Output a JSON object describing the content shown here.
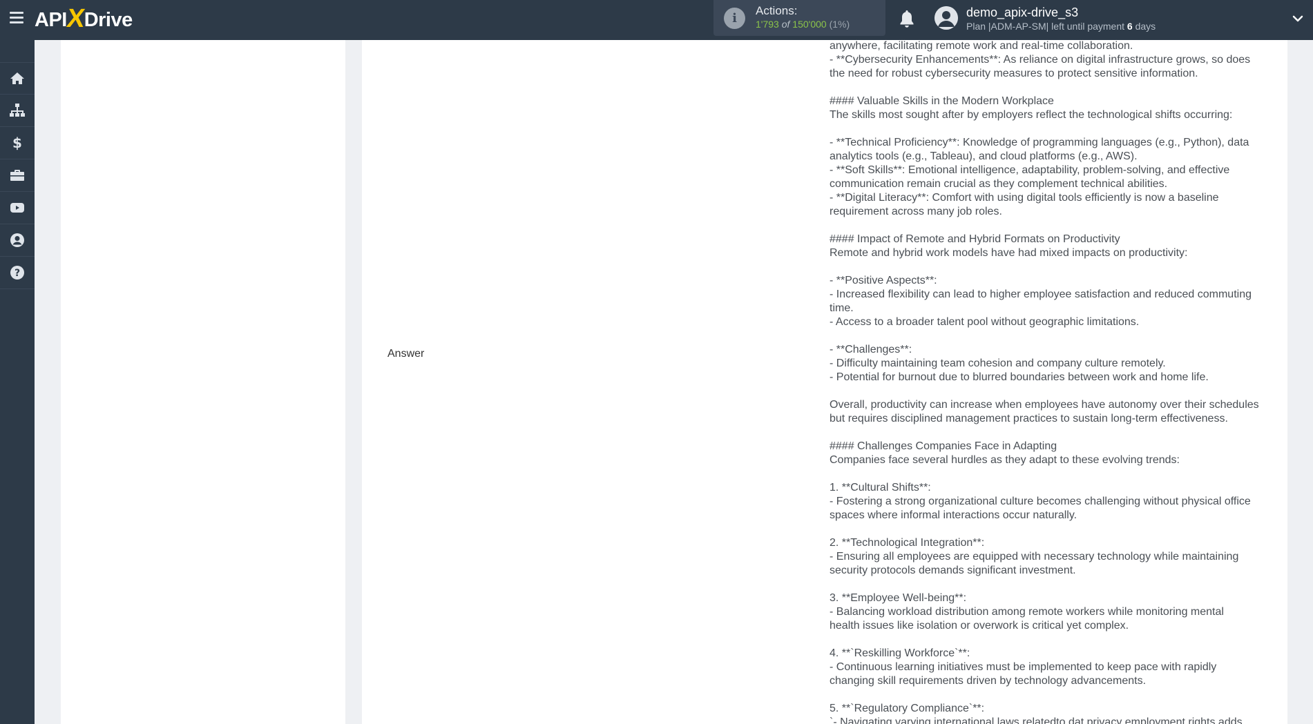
{
  "header": {
    "logo": {
      "api": "API",
      "x": "X",
      "drive": "Drive"
    },
    "actions": {
      "label": "Actions:",
      "used": "1'793",
      "of": "of",
      "total": "150'000",
      "percent": "(1%)"
    },
    "user": {
      "name": "demo_apix-drive_s3",
      "plan_prefix": "Plan |ADM-AP-SM| left until payment",
      "days_count": "6",
      "days_suffix": "days"
    },
    "icons": {
      "menu": "hamburger-menu-icon",
      "info": "info-icon",
      "bell": "bell-icon",
      "avatar": "user-avatar-icon",
      "expand": "chevron-down-icon"
    }
  },
  "sidebar": {
    "items": [
      {
        "icon": "home-icon"
      },
      {
        "icon": "sitemap-icon"
      },
      {
        "icon": "dollar-icon"
      },
      {
        "icon": "briefcase-icon"
      },
      {
        "icon": "youtube-icon"
      },
      {
        "icon": "user-icon"
      },
      {
        "icon": "help-icon"
      }
    ]
  },
  "main": {
    "answer_label": "Answer",
    "answer_lines": [
      "anywhere, facilitating remote work and real-time collaboration.",
      "- **Cybersecurity Enhancements**: As reliance on digital infrastructure grows, so does",
      "the need for robust cybersecurity measures to protect sensitive information.",
      "",
      "#### Valuable Skills in the Modern Workplace",
      "The skills most sought after by employers reflect the technological shifts occurring:",
      "",
      "- **Technical Proficiency**: Knowledge of programming languages (e.g., Python), data",
      "analytics tools (e.g., Tableau), and cloud platforms (e.g., AWS).",
      "- **Soft Skills**: Emotional intelligence, adaptability, problem-solving, and effective",
      "communication remain crucial as they complement technical abilities.",
      "- **Digital Literacy**: Comfort with using digital tools efficiently is now a baseline",
      "requirement across many job roles.",
      "",
      "#### Impact of Remote and Hybrid Formats on Productivity",
      "Remote and hybrid work models have had mixed impacts on productivity:",
      "",
      "- **Positive Aspects**:",
      "- Increased flexibility can lead to higher employee satisfaction and reduced commuting",
      "time.",
      "- Access to a broader talent pool without geographic limitations.",
      "",
      "- **Challenges**:",
      "- Difficulty maintaining team cohesion and company culture remotely.",
      "- Potential for burnout due to blurred boundaries between work and home life.",
      "",
      "Overall, productivity can increase when employees have autonomy over their schedules",
      "but requires disciplined management practices to sustain long-term effectiveness.",
      "",
      "#### Challenges Companies Face in Adapting",
      "Companies face several hurdles as they adapt to these evolving trends:",
      "",
      "1. **Cultural Shifts**:",
      "- Fostering a strong organizational culture becomes challenging without physical office",
      "spaces where informal interactions occur naturally.",
      "",
      "2. **Technological Integration**:",
      "- Ensuring all employees are equipped with necessary technology while maintaining",
      "security protocols demands significant investment.",
      "",
      "3. **Employee Well-being**:",
      "- Balancing workload distribution among remote workers while monitoring mental",
      "health issues like isolation or overwork is critical yet complex.",
      "",
      "4. **`Reskilling Workforce`**:",
      "- Continuous learning initiatives must be implemented to keep pace with rapidly",
      "changing skill requirements driven by technology advancements.",
      "",
      "5. **`Regulatory Compliance`**:",
      "`- Navigating varying international laws relatedto dat privacy employment rights adds"
    ]
  }
}
